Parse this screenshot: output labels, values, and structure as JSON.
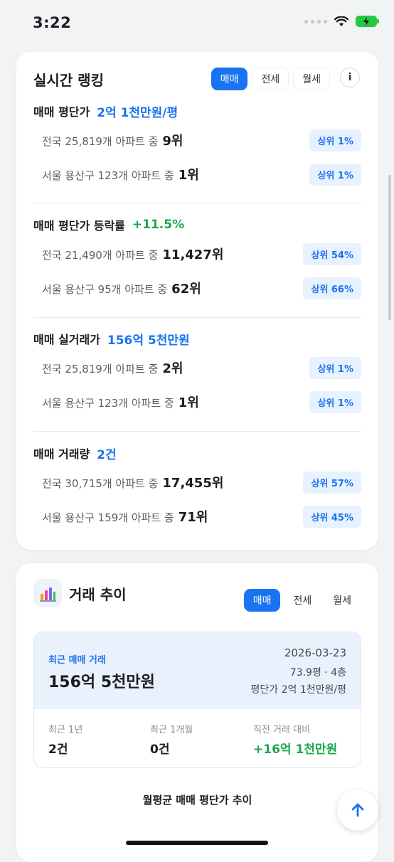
{
  "status": {
    "time": "3:22"
  },
  "ranking": {
    "title": "실시간 랭킹",
    "tabs": [
      {
        "label": "매매",
        "active": true
      },
      {
        "label": "전세",
        "active": false
      },
      {
        "label": "월세",
        "active": false
      }
    ],
    "info": "i",
    "sections": [
      {
        "label": "매매 평단가",
        "value": "2억 1천만원/평",
        "color": "blue",
        "rows": [
          {
            "text": "전국 25,819개 아파트 중",
            "rank": "9위",
            "badge": "상위 1%"
          },
          {
            "text": "서울 용산구 123개 아파트 중",
            "rank": "1위",
            "badge": "상위 1%"
          }
        ]
      },
      {
        "label": "매매 평단가 등락률",
        "value": "+11.5%",
        "color": "green",
        "rows": [
          {
            "text": "전국 21,490개 아파트 중",
            "rank": "11,427위",
            "badge": "상위 54%"
          },
          {
            "text": "서울 용산구 95개 아파트 중",
            "rank": "62위",
            "badge": "상위 66%"
          }
        ]
      },
      {
        "label": "매매 실거래가",
        "value": "156억 5천만원",
        "color": "blue",
        "rows": [
          {
            "text": "전국 25,819개 아파트 중",
            "rank": "2위",
            "badge": "상위 1%"
          },
          {
            "text": "서울 용산구 123개 아파트 중",
            "rank": "1위",
            "badge": "상위 1%"
          }
        ]
      },
      {
        "label": "매매 거래량",
        "value": "2건",
        "color": "blue",
        "rows": [
          {
            "text": "전국 30,715개 아파트 중",
            "rank": "17,455위",
            "badge": "상위 57%"
          },
          {
            "text": "서울 용산구 159개 아파트 중",
            "rank": "71위",
            "badge": "상위 45%"
          }
        ]
      }
    ]
  },
  "trend": {
    "title": "거래 추이",
    "tabs": [
      {
        "label": "매매",
        "active": true
      },
      {
        "label": "전세",
        "active": false
      },
      {
        "label": "월세",
        "active": false
      }
    ],
    "recent": {
      "label": "최근 매매 거래",
      "price": "156억 5천만원",
      "date": "2026-03-23",
      "size": "73.9평 · 4층",
      "unit_price": "평단가 2억 1천만원/평"
    },
    "stats": [
      {
        "label": "최근 1년",
        "value": "2건"
      },
      {
        "label": "최근 1개월",
        "value": "0건"
      },
      {
        "label": "직전 거래 대비",
        "value": "+16억 1천만원"
      }
    ],
    "chart_title": "월평균 매매 평단가 추이"
  },
  "colors": {
    "accent": "#1a73f0",
    "positive": "#1aa84b",
    "badge_bg": "#e8f1fe"
  }
}
